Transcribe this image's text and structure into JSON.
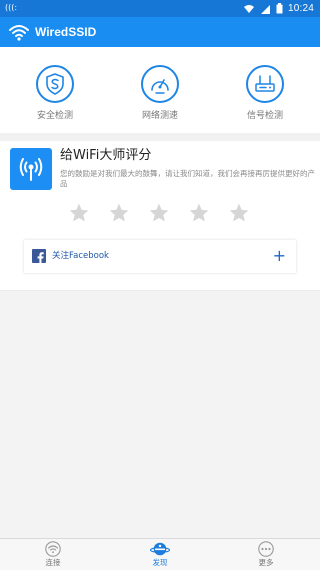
{
  "status_bar": {
    "left_text": "(((:",
    "time": "10:24",
    "icons": [
      "wifi-icon",
      "signal-icon",
      "battery-icon"
    ]
  },
  "app_bar": {
    "title": "WiredSSID",
    "logo_icon": "wifi-logo-icon"
  },
  "tools": [
    {
      "label": "安全检测",
      "icon": "shield-s-icon"
    },
    {
      "label": "网络测速",
      "icon": "speedometer-icon"
    },
    {
      "label": "信号检测",
      "icon": "router-icon"
    }
  ],
  "rating": {
    "title": "给WiFi大师评分",
    "description": "您的鼓励是对我们最大的鼓舞，请让我们知道，我们会再接再厉提供更好的产品",
    "stars": 5,
    "star_color": "#d6d6d6"
  },
  "facebook": {
    "label": "关注Facebook",
    "action": "+"
  },
  "bottom_nav": [
    {
      "label": "连接",
      "icon": "wifi-nav-icon",
      "active": false
    },
    {
      "label": "发现",
      "icon": "planet-icon",
      "active": true
    },
    {
      "label": "更多",
      "icon": "more-dots-icon",
      "active": false
    }
  ],
  "colors": {
    "status_bar": "#1777d6",
    "app_bar": "#1a8df2",
    "accent": "#1f86e6",
    "active_nav": "#1d7ddc",
    "facebook": "#3b5998"
  }
}
